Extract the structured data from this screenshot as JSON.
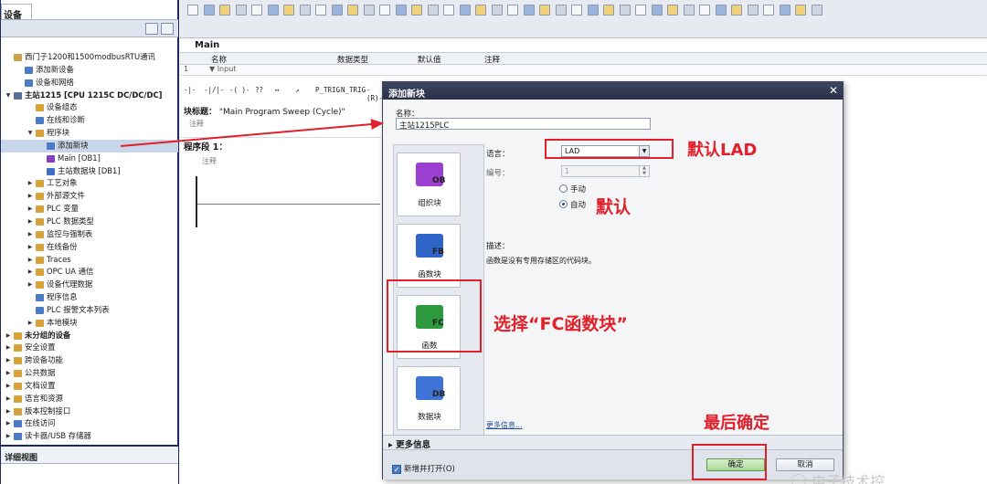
{
  "project_tree": {
    "tab_label": "设备",
    "items": [
      {
        "label": "西门子1200和1500modbusRTU通讯",
        "depth": 0,
        "arrow": "",
        "color": "#c9a24a"
      },
      {
        "label": "添加新设备",
        "depth": 1,
        "arrow": "",
        "color": "#4a7bc4"
      },
      {
        "label": "设备和网络",
        "depth": 1,
        "arrow": "",
        "color": "#4a7bc4"
      },
      {
        "label": "主站1215 [CPU 1215C DC/DC/DC]",
        "depth": 0,
        "arrow": "▼",
        "color": "#5a6f95",
        "bold": true
      },
      {
        "label": "设备组态",
        "depth": 2,
        "arrow": "",
        "color": "#d8a23a"
      },
      {
        "label": "在线和诊断",
        "depth": 2,
        "arrow": "",
        "color": "#4a7bc4"
      },
      {
        "label": "程序块",
        "depth": 2,
        "arrow": "▼",
        "color": "#d8a23a"
      },
      {
        "label": "添加新块",
        "depth": 3,
        "arrow": "",
        "color": "#4a7bc4",
        "selected": true
      },
      {
        "label": "Main [OB1]",
        "depth": 3,
        "arrow": "",
        "color": "#8a3fbf"
      },
      {
        "label": "主站数据块 [DB1]",
        "depth": 3,
        "arrow": "",
        "color": "#3f6ec9"
      },
      {
        "label": "工艺对象",
        "depth": 2,
        "arrow": "▶",
        "color": "#d8a23a"
      },
      {
        "label": "外部源文件",
        "depth": 2,
        "arrow": "▶",
        "color": "#d8a23a"
      },
      {
        "label": "PLC 变量",
        "depth": 2,
        "arrow": "▶",
        "color": "#d8a23a"
      },
      {
        "label": "PLC 数据类型",
        "depth": 2,
        "arrow": "▶",
        "color": "#d8a23a"
      },
      {
        "label": "监控与强制表",
        "depth": 2,
        "arrow": "▶",
        "color": "#d8a23a"
      },
      {
        "label": "在线备份",
        "depth": 2,
        "arrow": "▶",
        "color": "#d8a23a"
      },
      {
        "label": "Traces",
        "depth": 2,
        "arrow": "▶",
        "color": "#d8a23a"
      },
      {
        "label": "OPC UA 通信",
        "depth": 2,
        "arrow": "▶",
        "color": "#d8a23a"
      },
      {
        "label": "设备代理数据",
        "depth": 2,
        "arrow": "▶",
        "color": "#d8a23a"
      },
      {
        "label": "程序信息",
        "depth": 2,
        "arrow": "",
        "color": "#4a7bc4"
      },
      {
        "label": "PLC 报警文本列表",
        "depth": 2,
        "arrow": "",
        "color": "#4a7bc4"
      },
      {
        "label": "本地模块",
        "depth": 2,
        "arrow": "▶",
        "color": "#d8a23a"
      },
      {
        "label": "未分组的设备",
        "depth": 0,
        "arrow": "▶",
        "color": "#d8a23a",
        "bold": true
      },
      {
        "label": "安全设置",
        "depth": 0,
        "arrow": "▶",
        "color": "#d8a23a"
      },
      {
        "label": "跨设备功能",
        "depth": 0,
        "arrow": "▶",
        "color": "#d8a23a"
      },
      {
        "label": "公共数据",
        "depth": 0,
        "arrow": "▶",
        "color": "#d8a23a"
      },
      {
        "label": "文档设置",
        "depth": 0,
        "arrow": "▶",
        "color": "#d8a23a"
      },
      {
        "label": "语言和资源",
        "depth": 0,
        "arrow": "▶",
        "color": "#d8a23a"
      },
      {
        "label": "版本控制接口",
        "depth": 0,
        "arrow": "▶",
        "color": "#d8a23a"
      },
      {
        "label": "在线访问",
        "depth": 0,
        "arrow": "▶",
        "color": "#4a7bc4"
      },
      {
        "label": "读卡器/USB 存储器",
        "depth": 0,
        "arrow": "▶",
        "color": "#4a7bc4"
      }
    ],
    "detail_view_label": "详细视图"
  },
  "editor": {
    "block_name": "Main",
    "interface_headers": [
      "名称",
      "数据类型",
      "默认值",
      "注释"
    ],
    "interface_row": {
      "index": "1",
      "name": "▼ Input"
    },
    "lad_tools": [
      "-|-",
      "-|/|-",
      "-( )-",
      "??",
      "↦",
      "↗",
      "P_TRIG",
      "N_TRIG",
      "-(R)-"
    ],
    "block_title_label": "块标题：",
    "block_title_value": "\"Main Program Sweep (Cycle)\"",
    "comment_label": "注释",
    "segment_label": "程序段 1：",
    "segment_comment": "注释"
  },
  "dialog": {
    "title": "添加新块",
    "name_label": "名称：",
    "name_value": "主站1215PLC",
    "block_types": [
      {
        "code": "OB",
        "label": "组织块",
        "color": "#9b3fd1"
      },
      {
        "code": "FB",
        "label": "函数块",
        "color": "#2f64c9"
      },
      {
        "code": "FC",
        "label": "函数",
        "color": "#2e9a3e"
      },
      {
        "code": "DB",
        "label": "数据块",
        "color": "#3f74d6"
      }
    ],
    "language_label": "语言：",
    "language_value": "LAD",
    "number_label": "编号：",
    "number_value": "1",
    "radio_manual": "手动",
    "radio_auto": "自动",
    "description_label": "描述：",
    "description_text": "函数是没有专用存储区的代码块。",
    "more_info_link": "更多信息...",
    "more_info_section": "更多信息",
    "open_checkbox": "新增并打开(O)",
    "ok_label": "确定",
    "cancel_label": "取消"
  },
  "annotations": {
    "default_lad": "默认LAD",
    "default": "默认",
    "choose_fc": "选择“FC函数块”",
    "confirm": "最后确定",
    "color": "#e0202a"
  },
  "watermark": "电子技术控"
}
